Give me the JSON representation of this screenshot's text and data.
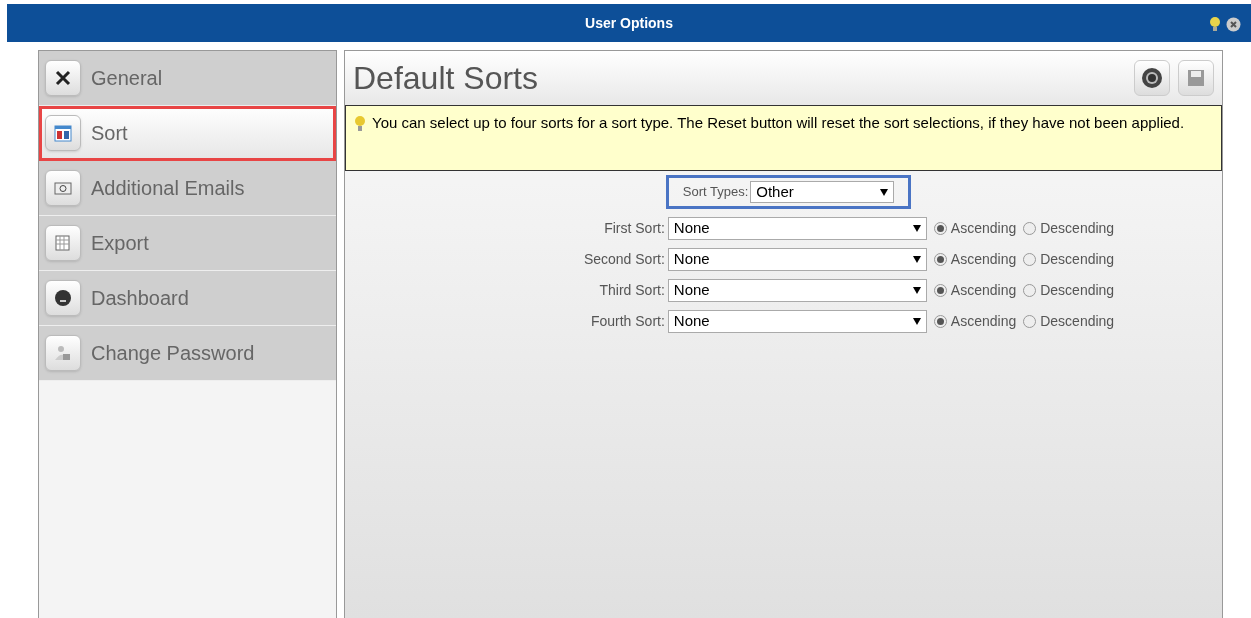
{
  "window": {
    "title": "User Options"
  },
  "sidebar": {
    "items": [
      {
        "label": "General",
        "selected": false
      },
      {
        "label": "Sort",
        "selected": true
      },
      {
        "label": "Additional Emails",
        "selected": false
      },
      {
        "label": "Export",
        "selected": false
      },
      {
        "label": "Dashboard",
        "selected": false
      },
      {
        "label": "Change Password",
        "selected": false
      }
    ]
  },
  "panel": {
    "title": "Default Sorts",
    "notice": "You can select up to four sorts for a sort type. The Reset button will reset the sort selections, if they have not been applied.",
    "sort_type": {
      "label": "Sort Types:",
      "value": "Other"
    },
    "sorts": [
      {
        "label": "First Sort:",
        "value": "None",
        "options": [
          {
            "label": "Ascending",
            "selected": true
          },
          {
            "label": "Descending",
            "selected": false
          }
        ]
      },
      {
        "label": "Second Sort:",
        "value": "None",
        "options": [
          {
            "label": "Ascending",
            "selected": true
          },
          {
            "label": "Descending",
            "selected": false
          }
        ]
      },
      {
        "label": "Third Sort:",
        "value": "None",
        "options": [
          {
            "label": "Ascending",
            "selected": true
          },
          {
            "label": "Descending",
            "selected": false
          }
        ]
      },
      {
        "label": "Fourth Sort:",
        "value": "None",
        "options": [
          {
            "label": "Ascending",
            "selected": true
          },
          {
            "label": "Descending",
            "selected": false
          }
        ]
      }
    ]
  }
}
